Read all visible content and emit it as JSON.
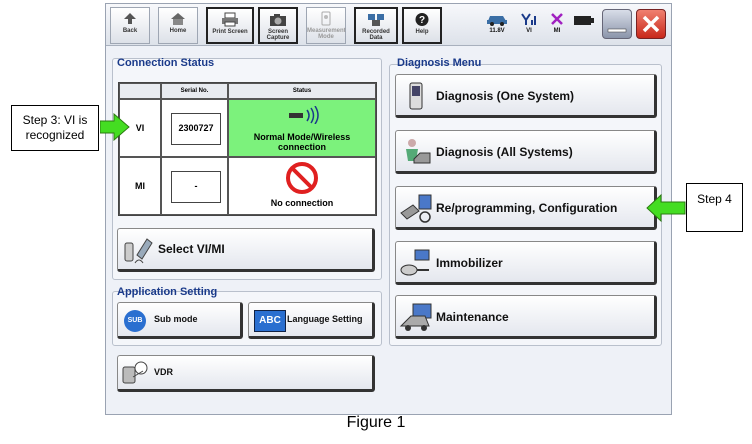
{
  "toolbar": {
    "buttons": [
      {
        "label": "Back",
        "icon": "back-arrow-icon"
      },
      {
        "label": "Home",
        "icon": "home-icon"
      },
      {
        "label": "Print Screen",
        "icon": "printer-icon"
      },
      {
        "label": "Screen Capture",
        "icon": "camera-icon"
      },
      {
        "label": "Measurement Mode",
        "icon": "measurement-icon"
      },
      {
        "label": "Recorded Data",
        "icon": "recorded-data-icon"
      },
      {
        "label": "Help",
        "icon": "help-icon"
      }
    ],
    "voltage": "11.8V",
    "vi_label": "VI",
    "mi_label": "MI"
  },
  "connection_status": {
    "title": "Connection Status",
    "headers": [
      "Serial No.",
      "Status"
    ],
    "rows": [
      {
        "name": "VI",
        "serial": "2300727",
        "status": "Normal Mode/Wireless connection"
      },
      {
        "name": "MI",
        "serial": "-",
        "status": "No connection"
      }
    ],
    "select_button": "Select VI/MI"
  },
  "application_setting": {
    "title": "Application Setting",
    "sub_mode_icon_text": "SUB",
    "sub_mode": "Sub mode",
    "language_icon_text": "ABC",
    "language": "Language Setting",
    "vdr": "VDR"
  },
  "diagnosis_menu": {
    "title": "Diagnosis Menu",
    "items": [
      "Diagnosis (One System)",
      "Diagnosis (All Systems)",
      "Re/programming, Configuration",
      "Immobilizer",
      "Maintenance"
    ]
  },
  "callouts": {
    "step3": "Step 3: VI is recognized",
    "step4": "Step 4"
  },
  "figure_caption": "Figure 1",
  "colors": {
    "status_ok": "#7cf27c",
    "arrow": "#44dd22",
    "title": "#1a3a8a"
  }
}
